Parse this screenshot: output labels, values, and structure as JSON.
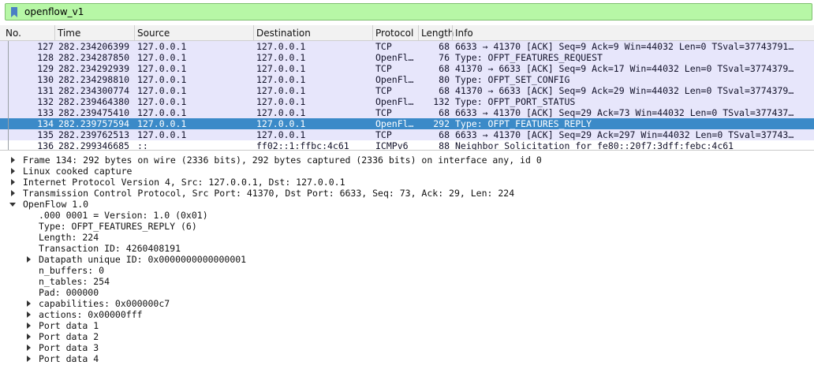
{
  "filter": {
    "value": "openflow_v1"
  },
  "columns": [
    "No.",
    "Time",
    "Source",
    "Destination",
    "Protocol",
    "Length",
    "Info"
  ],
  "packets": [
    {
      "no": "127",
      "time": "282.234206399",
      "src": "127.0.0.1",
      "dst": "127.0.0.1",
      "proto": "TCP",
      "len": "68",
      "info": "6633 → 41370 [ACK] Seq=9 Ack=9 Win=44032 Len=0 TSval=37743791…"
    },
    {
      "no": "128",
      "time": "282.234287850",
      "src": "127.0.0.1",
      "dst": "127.0.0.1",
      "proto": "OpenFl…",
      "len": "76",
      "info": "Type: OFPT_FEATURES_REQUEST"
    },
    {
      "no": "129",
      "time": "282.234292939",
      "src": "127.0.0.1",
      "dst": "127.0.0.1",
      "proto": "TCP",
      "len": "68",
      "info": "41370 → 6633 [ACK] Seq=9 Ack=17 Win=44032 Len=0 TSval=3774379…"
    },
    {
      "no": "130",
      "time": "282.234298810",
      "src": "127.0.0.1",
      "dst": "127.0.0.1",
      "proto": "OpenFl…",
      "len": "80",
      "info": "Type: OFPT_SET_CONFIG"
    },
    {
      "no": "131",
      "time": "282.234300774",
      "src": "127.0.0.1",
      "dst": "127.0.0.1",
      "proto": "TCP",
      "len": "68",
      "info": "41370 → 6633 [ACK] Seq=9 Ack=29 Win=44032 Len=0 TSval=3774379…"
    },
    {
      "no": "132",
      "time": "282.239464380",
      "src": "127.0.0.1",
      "dst": "127.0.0.1",
      "proto": "OpenFl…",
      "len": "132",
      "info": "Type: OFPT_PORT_STATUS"
    },
    {
      "no": "133",
      "time": "282.239475410",
      "src": "127.0.0.1",
      "dst": "127.0.0.1",
      "proto": "TCP",
      "len": "68",
      "info": "6633 → 41370 [ACK] Seq=29 Ack=73 Win=44032 Len=0 TSval=377437…"
    },
    {
      "no": "134",
      "time": "282.239757594",
      "src": "127.0.0.1",
      "dst": "127.0.0.1",
      "proto": "OpenFl…",
      "len": "292",
      "info": "Type: OFPT_FEATURES_REPLY"
    },
    {
      "no": "135",
      "time": "282.239762513",
      "src": "127.0.0.1",
      "dst": "127.0.0.1",
      "proto": "TCP",
      "len": "68",
      "info": "6633 → 41370 [ACK] Seq=29 Ack=297 Win=44032 Len=0 TSval=37743…"
    },
    {
      "no": "136",
      "time": "282.299346685",
      "src": "::",
      "dst": "ff02::1:ffbc:4c61",
      "proto": "ICMPv6",
      "len": "88",
      "info": "Neighbor Solicitation for fe80::20f7:3dff:febc:4c61"
    }
  ],
  "details": [
    {
      "text": "Frame 134: 292 bytes on wire (2336 bits), 292 bytes captured (2336 bits) on interface any, id 0",
      "level": 0,
      "expander": "collapsed"
    },
    {
      "text": "Linux cooked capture",
      "level": 0,
      "expander": "collapsed"
    },
    {
      "text": "Internet Protocol Version 4, Src: 127.0.0.1, Dst: 127.0.0.1",
      "level": 0,
      "expander": "collapsed"
    },
    {
      "text": "Transmission Control Protocol, Src Port: 41370, Dst Port: 6633, Seq: 73, Ack: 29, Len: 224",
      "level": 0,
      "expander": "collapsed"
    },
    {
      "text": "OpenFlow 1.0",
      "level": 0,
      "expander": "expanded"
    },
    {
      "text": ".000 0001 = Version: 1.0 (0x01)",
      "level": 1,
      "expander": "none"
    },
    {
      "text": "Type: OFPT_FEATURES_REPLY (6)",
      "level": 1,
      "expander": "none"
    },
    {
      "text": "Length: 224",
      "level": 1,
      "expander": "none"
    },
    {
      "text": "Transaction ID: 4260408191",
      "level": 1,
      "expander": "none"
    },
    {
      "text": "Datapath unique ID: 0x0000000000000001",
      "level": 1,
      "expander": "collapsed"
    },
    {
      "text": "n_buffers: 0",
      "level": 1,
      "expander": "none"
    },
    {
      "text": "n_tables: 254",
      "level": 1,
      "expander": "none"
    },
    {
      "text": "Pad: 000000",
      "level": 1,
      "expander": "none"
    },
    {
      "text": "capabilities: 0x000000c7",
      "level": 1,
      "expander": "collapsed"
    },
    {
      "text": "actions: 0x00000fff",
      "level": 1,
      "expander": "collapsed"
    },
    {
      "text": "Port data 1",
      "level": 1,
      "expander": "collapsed"
    },
    {
      "text": "Port data 2",
      "level": 1,
      "expander": "collapsed"
    },
    {
      "text": "Port data 3",
      "level": 1,
      "expander": "collapsed"
    },
    {
      "text": "Port data 4",
      "level": 1,
      "expander": "collapsed"
    }
  ],
  "selected_no": "134"
}
